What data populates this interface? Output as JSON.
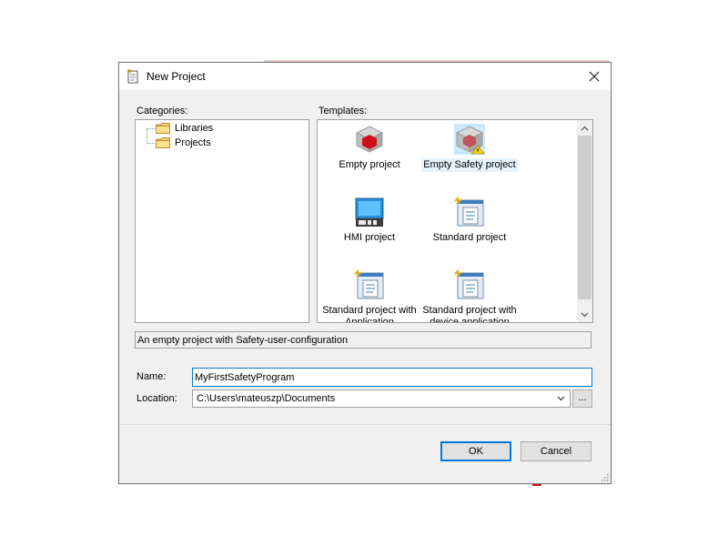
{
  "dialog": {
    "title": "New Project",
    "close_icon": "close-icon",
    "title_icon": "document-icon"
  },
  "categories": {
    "label": "Categories:",
    "items": [
      {
        "label": "Libraries",
        "icon": "folder-icon"
      },
      {
        "label": "Projects",
        "icon": "folder-icon"
      }
    ]
  },
  "templates": {
    "label": "Templates:",
    "items": [
      {
        "label": "Empty project",
        "icon": "red-cube-icon"
      },
      {
        "label": "Empty Safety project",
        "icon": "safety-cube-icon",
        "selected": true
      },
      {
        "label": "HMI project",
        "icon": "hmi-icon"
      },
      {
        "label": "Standard project",
        "icon": "standard-project-icon"
      },
      {
        "label": "Standard project with Application Composer",
        "icon": "standard-project-icon"
      },
      {
        "label": "Standard project with device application",
        "icon": "standard-project-icon"
      }
    ]
  },
  "description": "An empty project with Safety-user-configuration",
  "form": {
    "name_label": "Name:",
    "name_value": "MyFirstSafetyProgram",
    "location_label": "Location:",
    "location_value": "C:\\Users\\mateuszp\\Documents",
    "browse_label": "..."
  },
  "buttons": {
    "ok": "OK",
    "cancel": "Cancel"
  },
  "colors": {
    "accent": "#0078d7",
    "dialog_bg": "#f0f0f0"
  }
}
